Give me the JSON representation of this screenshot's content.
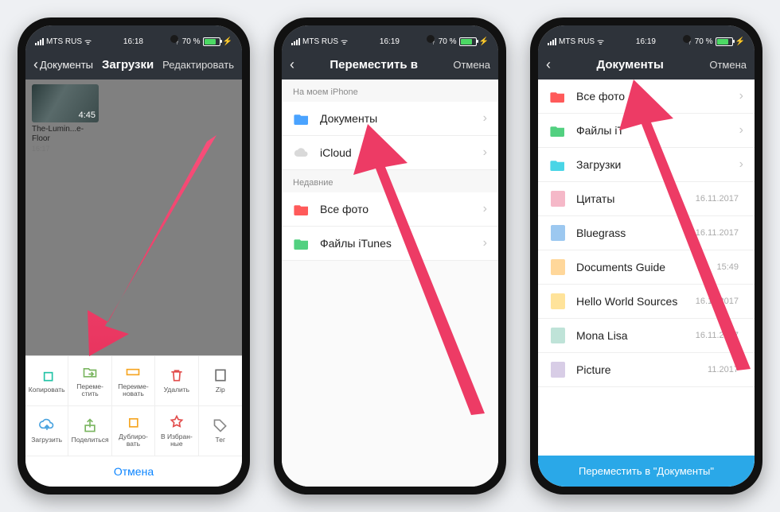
{
  "status": {
    "carrier": "MTS RUS",
    "time_p1": "16:18",
    "time_p23": "16:19",
    "bt": "70 %",
    "bt_icon": "⚡"
  },
  "p1": {
    "back": "Документы",
    "title": "Загрузки",
    "edit": "Редактировать",
    "thumb": {
      "duration": "4:45",
      "name": "The-Lumin...e-Floor",
      "time": "16:17"
    },
    "actions": [
      {
        "icon": "copy",
        "label": "Копировать",
        "color": "#22c3a6"
      },
      {
        "icon": "move",
        "label": "Переме-\nстить",
        "color": "#7bb661"
      },
      {
        "icon": "rename",
        "label": "Переиме-\nновать",
        "color": "#f6a623"
      },
      {
        "icon": "delete",
        "label": "Удалить",
        "color": "#e24c4b"
      },
      {
        "icon": "zip",
        "label": "Zip",
        "color": "#6e6e6e"
      },
      {
        "icon": "upload",
        "label": "Загрузить",
        "color": "#4aa3df"
      },
      {
        "icon": "share",
        "label": "Поделиться",
        "color": "#7bb661"
      },
      {
        "icon": "duplicate",
        "label": "Дублиро-\nвать",
        "color": "#f6a623"
      },
      {
        "icon": "fav",
        "label": "В Избран-\nные",
        "color": "#e24c4b"
      },
      {
        "icon": "tag",
        "label": "Тег",
        "color": "#888"
      }
    ],
    "cancel": "Отмена"
  },
  "p2": {
    "title": "Переместить в",
    "cancel": "Отмена",
    "section1": "На моем iPhone",
    "items1": [
      {
        "icon": "folder-blue",
        "label": "Документы"
      },
      {
        "icon": "cloud",
        "label": "iCloud"
      }
    ],
    "section2": "Недавние",
    "items2": [
      {
        "icon": "folder-red",
        "label": "Все фото"
      },
      {
        "icon": "folder-green",
        "label": "Файлы iTunes"
      }
    ]
  },
  "p3": {
    "title": "Документы",
    "cancel": "Отмена",
    "items": [
      {
        "icon": "folder-red",
        "label": "Все фото",
        "chev": true
      },
      {
        "icon": "folder-green",
        "label": "Файлы iT",
        "chev": true
      },
      {
        "icon": "folder-cyan",
        "label": "Загрузки",
        "chev": true
      },
      {
        "icon": "txt-pink",
        "label": "Цитаты",
        "meta": "16.11.2017"
      },
      {
        "icon": "note-blue",
        "label": "Bluegrass",
        "meta": "16.11.2017"
      },
      {
        "icon": "doc-orange",
        "label": "Documents Guide",
        "meta": "15:49"
      },
      {
        "icon": "doc-yellow",
        "label": "Hello World Sources",
        "meta": "16.11.2017"
      },
      {
        "icon": "img",
        "label": "Mona Lisa",
        "meta": "16.11.2017"
      },
      {
        "icon": "img2",
        "label": "Picture",
        "meta": "11.2017"
      }
    ],
    "footer": "Переместить в \"Документы\""
  }
}
